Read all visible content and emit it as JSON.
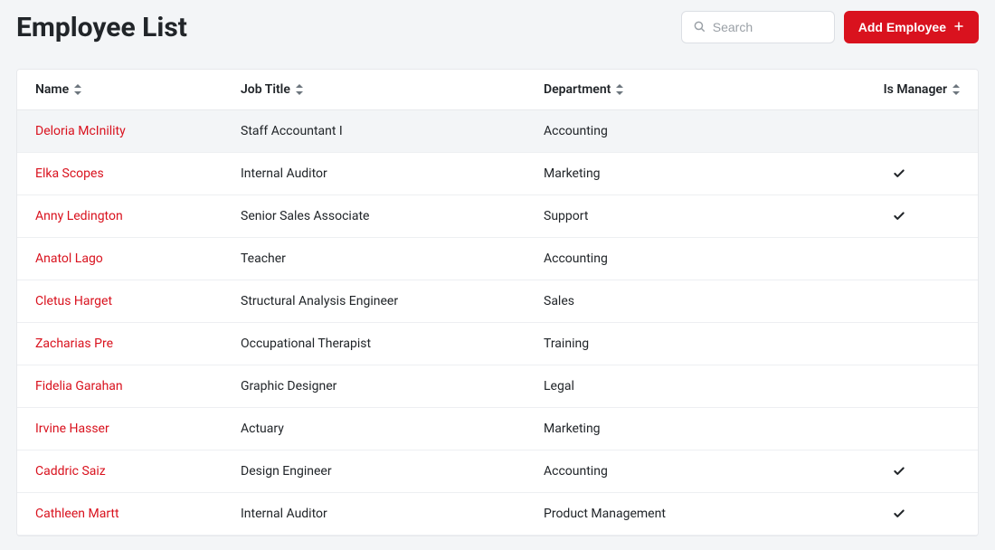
{
  "header": {
    "title": "Employee List",
    "search_placeholder": "Search",
    "add_button_label": "Add Employee"
  },
  "columns": {
    "name": "Name",
    "job_title": "Job Title",
    "department": "Department",
    "is_manager": "Is Manager"
  },
  "rows": [
    {
      "name": "Deloria McInility",
      "job_title": "Staff Accountant I",
      "department": "Accounting",
      "is_manager": false
    },
    {
      "name": "Elka Scopes",
      "job_title": "Internal Auditor",
      "department": "Marketing",
      "is_manager": true
    },
    {
      "name": "Anny Ledington",
      "job_title": "Senior Sales Associate",
      "department": "Support",
      "is_manager": true
    },
    {
      "name": "Anatol Lago",
      "job_title": "Teacher",
      "department": "Accounting",
      "is_manager": false
    },
    {
      "name": "Cletus Harget",
      "job_title": "Structural Analysis Engineer",
      "department": "Sales",
      "is_manager": false
    },
    {
      "name": "Zacharias Pre",
      "job_title": "Occupational Therapist",
      "department": "Training",
      "is_manager": false
    },
    {
      "name": "Fidelia Garahan",
      "job_title": "Graphic Designer",
      "department": "Legal",
      "is_manager": false
    },
    {
      "name": "Irvine Hasser",
      "job_title": "Actuary",
      "department": "Marketing",
      "is_manager": false
    },
    {
      "name": "Caddric Saiz",
      "job_title": "Design Engineer",
      "department": "Accounting",
      "is_manager": true
    },
    {
      "name": "Cathleen Martt",
      "job_title": "Internal Auditor",
      "department": "Product Management",
      "is_manager": true
    }
  ],
  "colors": {
    "accent": "#d9121e",
    "page_bg": "#f3f5f7"
  }
}
